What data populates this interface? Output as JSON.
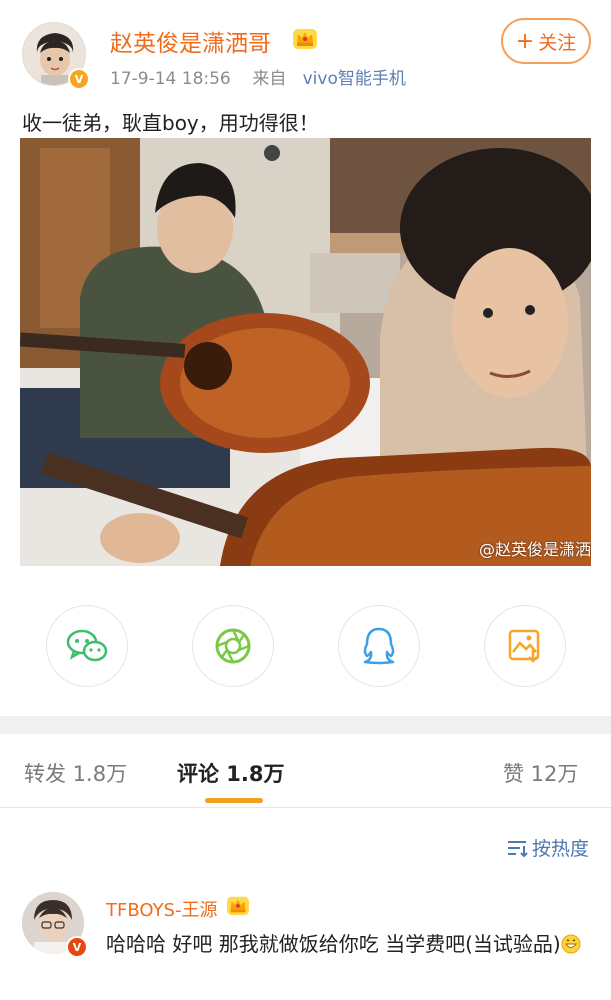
{
  "post": {
    "username": "赵英俊是潇洒哥",
    "time": "17-9-14 18:56",
    "source_prefix": "来自",
    "source": "vivo智能手机",
    "follow_label": "关注",
    "text": "收一徒弟，耿直boy，用功得很！",
    "watermark": "@赵英俊是潇洒"
  },
  "share": {
    "items": [
      {
        "icon": "wechat-icon"
      },
      {
        "icon": "moments-icon"
      },
      {
        "icon": "qq-icon"
      },
      {
        "icon": "save-image-icon"
      }
    ]
  },
  "tabs": {
    "repost": "转发 1.8万",
    "comment": "评论 1.8万",
    "like": "赞 12万"
  },
  "sort": {
    "label": "按热度"
  },
  "comment": {
    "username": "TFBOYS-王源",
    "text": "哈哈哈 好吧 那我就做饭给你吃 当学费吧(当试验品)"
  },
  "colors": {
    "brand_orange": "#f26b1a",
    "link_blue": "#5a80b5",
    "tab_underline": "#f0a021"
  }
}
